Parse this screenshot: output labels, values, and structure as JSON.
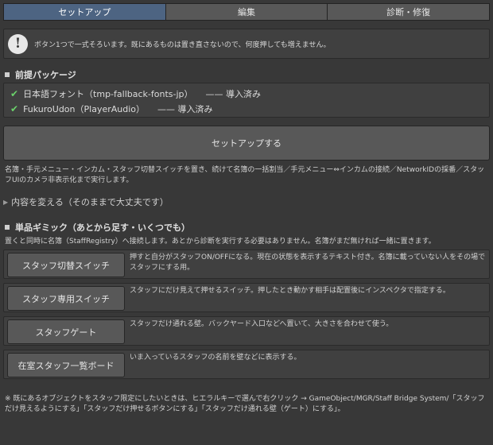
{
  "tabs": [
    {
      "label": "セットアップ",
      "active": true
    },
    {
      "label": "編集",
      "active": false
    },
    {
      "label": "診断・修復",
      "active": false
    }
  ],
  "info": {
    "icon": "info-icon",
    "glyph": "!",
    "text": "ボタン1つで一式そろいます。既にあるものは置き直さないので、何度押しても増えません。"
  },
  "prereq": {
    "title": "前提パッケージ",
    "items": [
      {
        "name": "日本語フォント（tmp-fallback-fonts-jp）",
        "status": "—— 導入済み"
      },
      {
        "name": "FukuroUdon（PlayerAudio）",
        "status": "—— 導入済み"
      }
    ],
    "check_color": "#6bd16b"
  },
  "setup_button": "セットアップする",
  "setup_description": "名簿・手元メニュー・インカム・スタッフ切替スイッチを置き、続けて名簿の一括割当／手元メニュー⇔インカムの接続／NetworkIDの採番／スタッフUIのカメラ非表示化まで実行します。",
  "foldout": "内容を変える（そのままで大丈夫です）",
  "gimmicks": {
    "title": "単品ギミック（あとから足す・いくつでも）",
    "subtitle": "置くと同時に名簿（StaffRegistry）へ接続します。あとから診断を実行する必要はありません。名簿がまだ無ければ一緒に置きます。",
    "items": [
      {
        "button": "スタッフ切替スイッチ",
        "desc": "押すと自分がスタッフON/OFFになる。現在の状態を表示するテキスト付き。名簿に載っていない人をその場でスタッフにする用。"
      },
      {
        "button": "スタッフ専用スイッチ",
        "desc": "スタッフにだけ見えて押せるスイッチ。押したとき動かす相手は配置後にインスペクタで指定する。"
      },
      {
        "button": "スタッフゲート",
        "desc": "スタッフだけ通れる壁。バックヤード入口などへ置いて、大きさを合わせて使う。"
      },
      {
        "button": "在室スタッフ一覧ボード",
        "desc": "いま入っているスタッフの名前を壁などに表示する。"
      }
    ]
  },
  "footnote": "※ 既にあるオブジェクトをスタッフ限定にしたいときは、ヒエラルキーで選んで右クリック → GameObject/MGR/Staff Bridge System/「スタッフだけ見えるようにする」「スタッフだけ押せるボタンにする」「スタッフだけ通れる壁（ゲート）にする」。",
  "colors": {
    "background": "#383838",
    "active_tab": "#4d6482",
    "button": "#585858"
  }
}
